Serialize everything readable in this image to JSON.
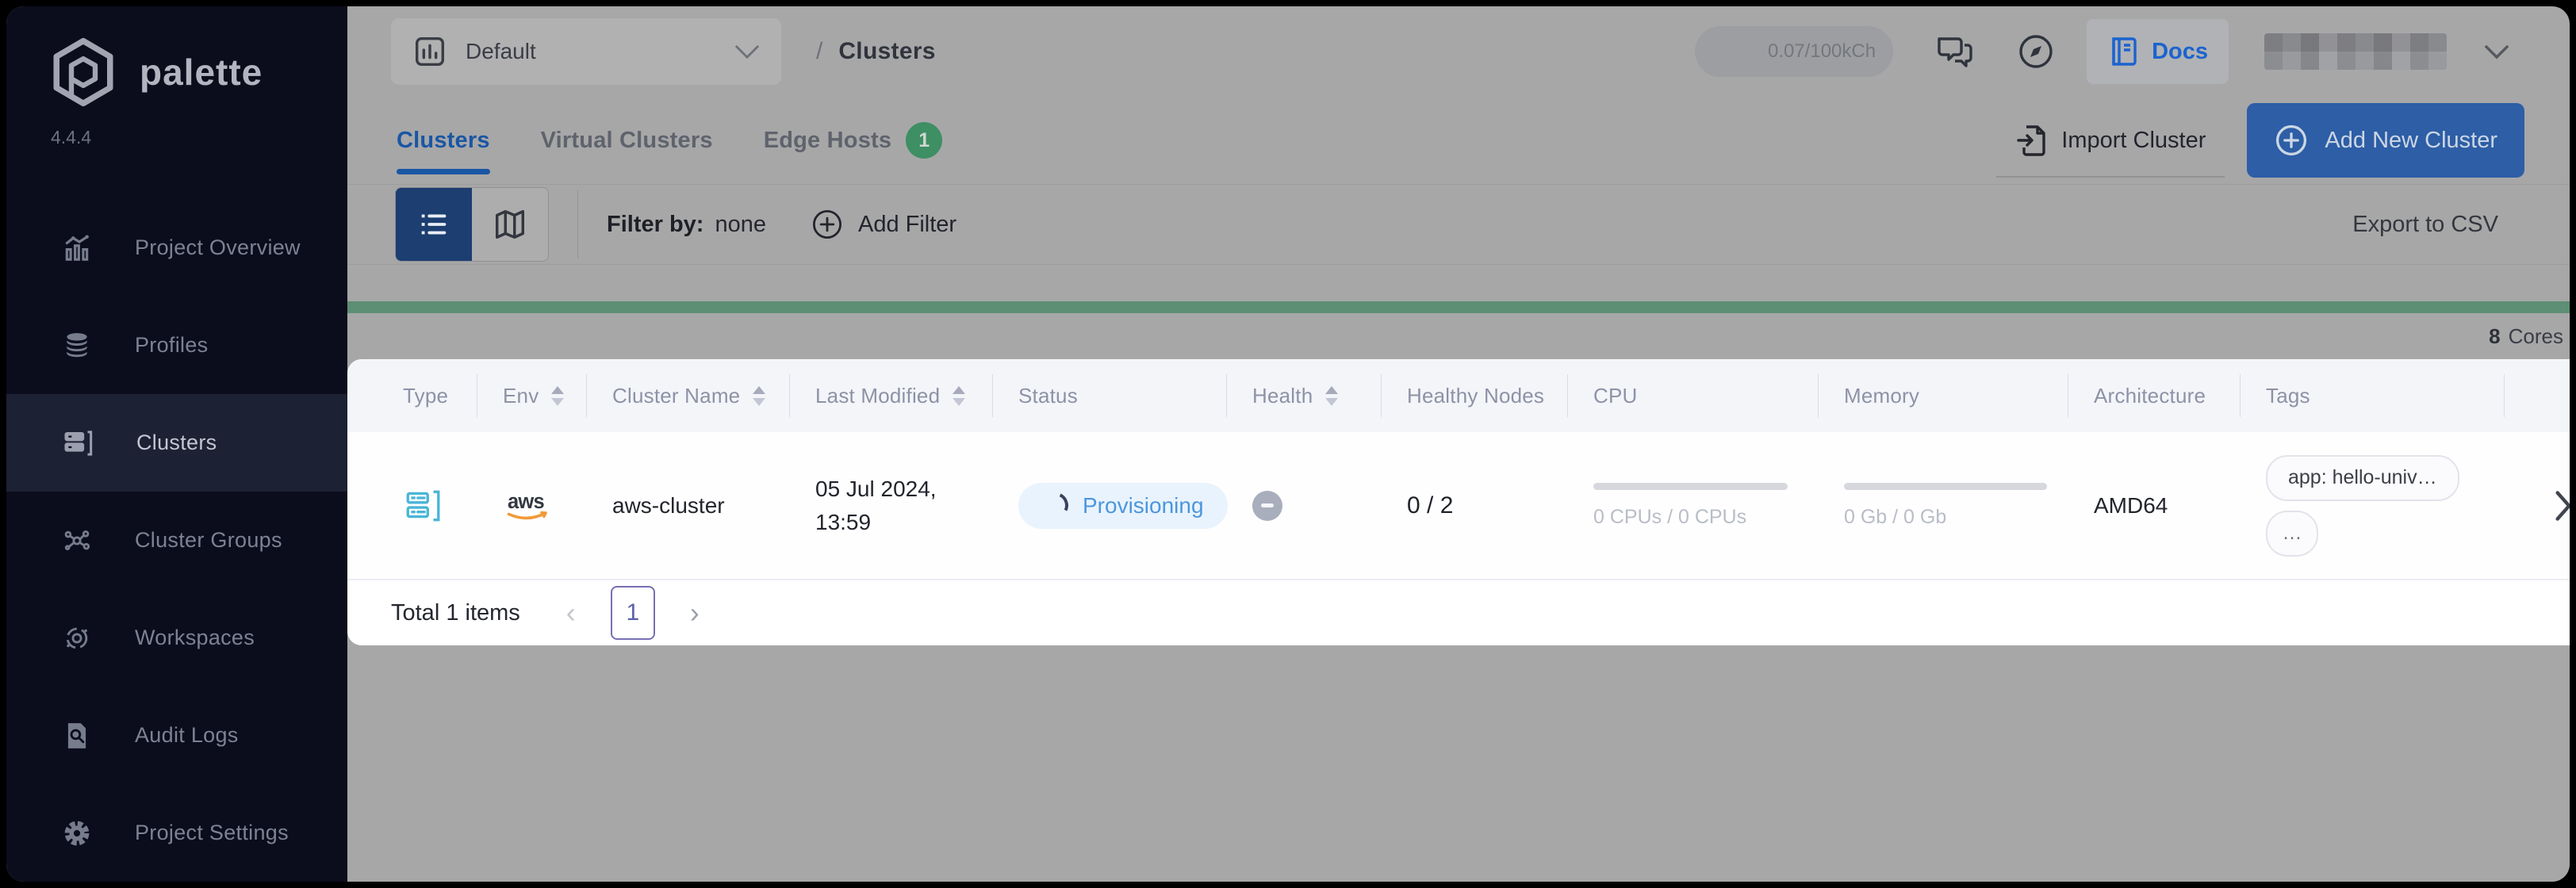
{
  "sidebar": {
    "logo_text": "palette",
    "version": "4.4.4",
    "items": [
      {
        "label": "Project Overview"
      },
      {
        "label": "Profiles"
      },
      {
        "label": "Clusters"
      },
      {
        "label": "Cluster Groups"
      },
      {
        "label": "Workspaces"
      },
      {
        "label": "Audit Logs"
      },
      {
        "label": "Project Settings"
      }
    ]
  },
  "topbar": {
    "project_selector": "Default",
    "breadcrumb_separator": "/",
    "breadcrumb_page": "Clusters",
    "usage_badge": "0.07/100kCh",
    "docs_label": "Docs"
  },
  "tabs": {
    "items": [
      {
        "label": "Clusters"
      },
      {
        "label": "Virtual Clusters"
      },
      {
        "label": "Edge Hosts",
        "badge": "1"
      }
    ],
    "import_label": "Import Cluster",
    "add_label": "Add New Cluster"
  },
  "toolbar": {
    "filter_label": "Filter by:",
    "filter_value": "none",
    "add_filter_label": "Add Filter",
    "export_label": "Export to CSV"
  },
  "usage_bar": {
    "cores_value": "8",
    "cores_unit": "Cores"
  },
  "table": {
    "columns": [
      {
        "label": "Type"
      },
      {
        "label": "Env"
      },
      {
        "label": "Cluster Name"
      },
      {
        "label": "Last Modified"
      },
      {
        "label": "Status"
      },
      {
        "label": "Health"
      },
      {
        "label": "Healthy Nodes"
      },
      {
        "label": "CPU"
      },
      {
        "label": "Memory"
      },
      {
        "label": "Architecture"
      },
      {
        "label": "Tags"
      }
    ],
    "row": {
      "env": "aws",
      "cluster_name": "aws-cluster",
      "last_modified_line1": "05 Jul 2024,",
      "last_modified_line2": "13:59",
      "status": "Provisioning",
      "healthy_nodes": "0 / 2",
      "cpu_usage": "0 CPUs / 0 CPUs",
      "memory_usage": "0 Gb / 0 Gb",
      "architecture": "AMD64",
      "tags": [
        "app: hello-univ…",
        "…"
      ]
    }
  },
  "pagination": {
    "total_label": "Total 1 items",
    "current_page": "1"
  },
  "colors": {
    "sidebar_bg": "#0b0d1d",
    "accent_blue": "#1a56a4",
    "button_blue": "#2d5ea6",
    "green_bar": "#5d8f75",
    "badge_green": "#3e8f63",
    "status_blue": "#4b96dd"
  }
}
